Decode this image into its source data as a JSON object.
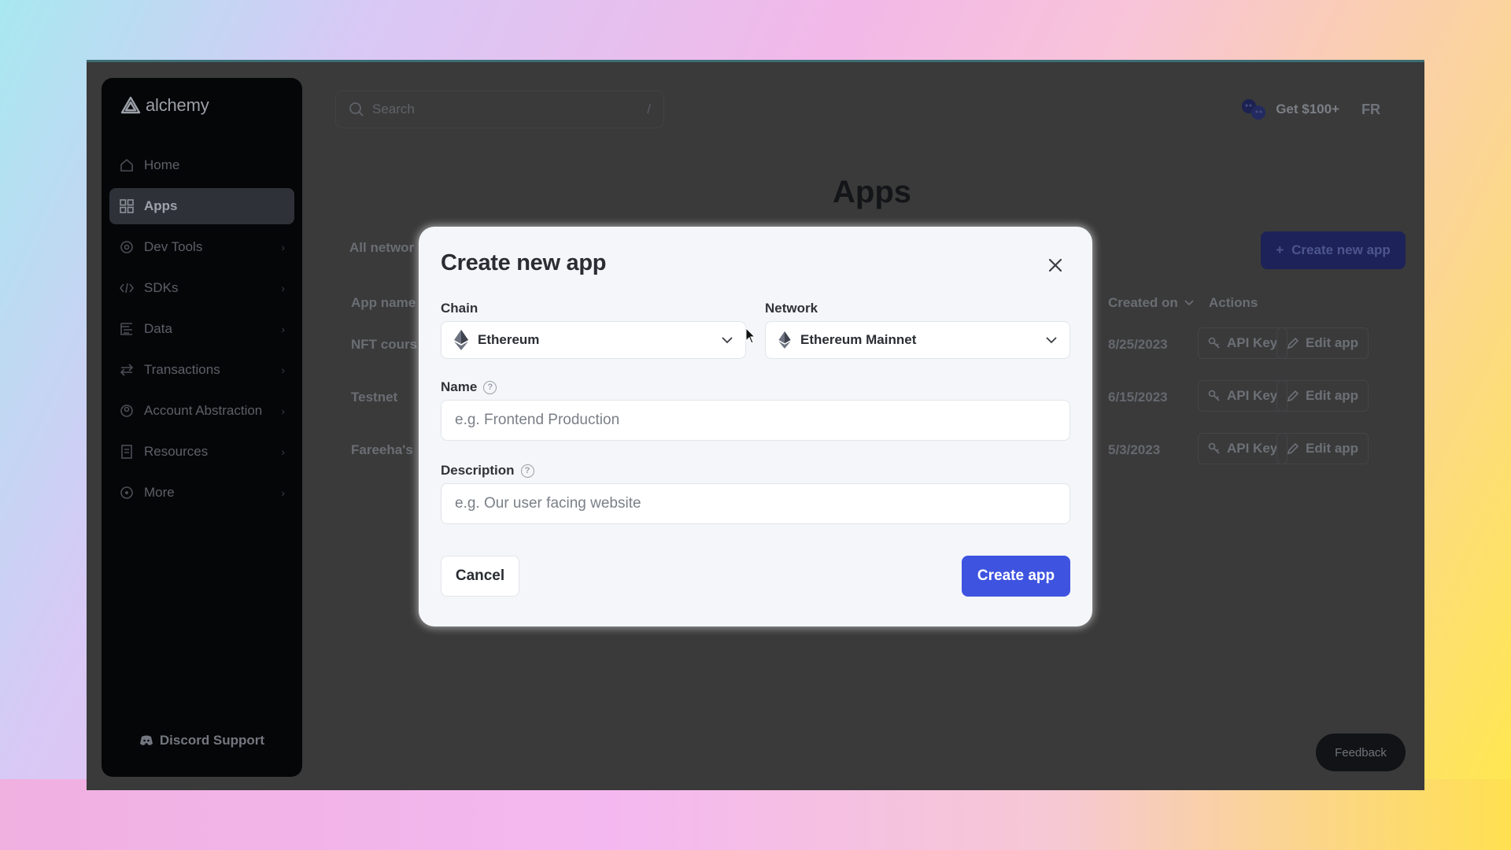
{
  "sidebar": {
    "logo_text": "alchemy",
    "items": [
      {
        "label": "Home",
        "icon": "home-icon",
        "has_chevron": false
      },
      {
        "label": "Apps",
        "icon": "grid-icon",
        "has_chevron": false,
        "active": true
      },
      {
        "label": "Dev Tools",
        "icon": "gear-icon",
        "has_chevron": true
      },
      {
        "label": "SDKs",
        "icon": "code-icon",
        "has_chevron": true
      },
      {
        "label": "Data",
        "icon": "data-icon",
        "has_chevron": true
      },
      {
        "label": "Transactions",
        "icon": "transfer-icon",
        "has_chevron": true
      },
      {
        "label": "Account Abstraction",
        "icon": "account-icon",
        "has_chevron": true
      },
      {
        "label": "Resources",
        "icon": "book-icon",
        "has_chevron": true
      },
      {
        "label": "More",
        "icon": "more-icon",
        "has_chevron": true
      }
    ],
    "discord_label": "Discord Support"
  },
  "header": {
    "search_placeholder": "Search",
    "search_shortcut": "/",
    "promo_label": "Get $100+",
    "user_initials": "FR"
  },
  "page": {
    "title": "Apps",
    "network_filter": "All networ",
    "create_new_label": "Create new app",
    "columns": {
      "name": "App name",
      "created": "Created on",
      "actions": "Actions"
    },
    "rows": [
      {
        "name": "NFT cours",
        "created": "8/25/2023"
      },
      {
        "name": "Testnet",
        "created": "6/15/2023"
      },
      {
        "name": "Fareeha's",
        "created": "5/3/2023"
      }
    ],
    "api_key_label": "API Key",
    "edit_app_label": "Edit app",
    "feedback_label": "Feedback"
  },
  "modal": {
    "title": "Create new app",
    "chain_label": "Chain",
    "chain_value": "Ethereum",
    "network_label": "Network",
    "network_value": "Ethereum Mainnet",
    "name_label": "Name",
    "name_placeholder": "e.g. Frontend Production",
    "description_label": "Description",
    "description_placeholder": "e.g. Our user facing website",
    "cancel_label": "Cancel",
    "create_label": "Create app"
  },
  "colors": {
    "primary_button": "#3e54e0",
    "sidebar_bg": "#050608",
    "overlay_bg": "#3a3a3a",
    "modal_bg": "#f4f6f9"
  }
}
